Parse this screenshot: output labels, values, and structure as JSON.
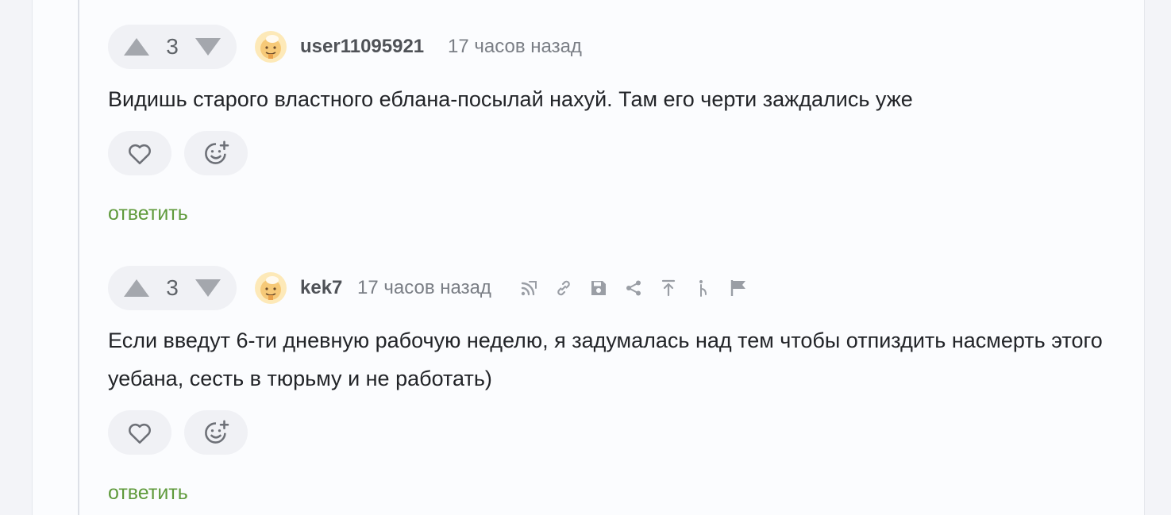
{
  "comments": [
    {
      "score": "3",
      "username": "user11095921",
      "time": "17 часов назад",
      "text": "Видишь старого властного еблана-посылай нахуй. Там его черти заждались уже",
      "reply_label": "ответить",
      "show_tools": false
    },
    {
      "score": "3",
      "username": "kek7",
      "time": "17 часов назад",
      "text": "Если введут 6-ти дневную рабочую неделю, я задумалась над тем чтобы отпиздить насмерть этого уебана, сесть в тюрьму и не работать)",
      "reply_label": "ответить",
      "show_tools": true,
      "tools": [
        "thread-icon",
        "link-icon",
        "save-icon",
        "share-icon",
        "scroll-up-icon",
        "branch-icon",
        "report-flag-icon"
      ]
    }
  ],
  "colors": {
    "accent_green": "#5f9a3b",
    "rating_bg": "#f0f1f5",
    "arrow": "#a4a7ad",
    "avatar_bg": "#fde9b8"
  }
}
